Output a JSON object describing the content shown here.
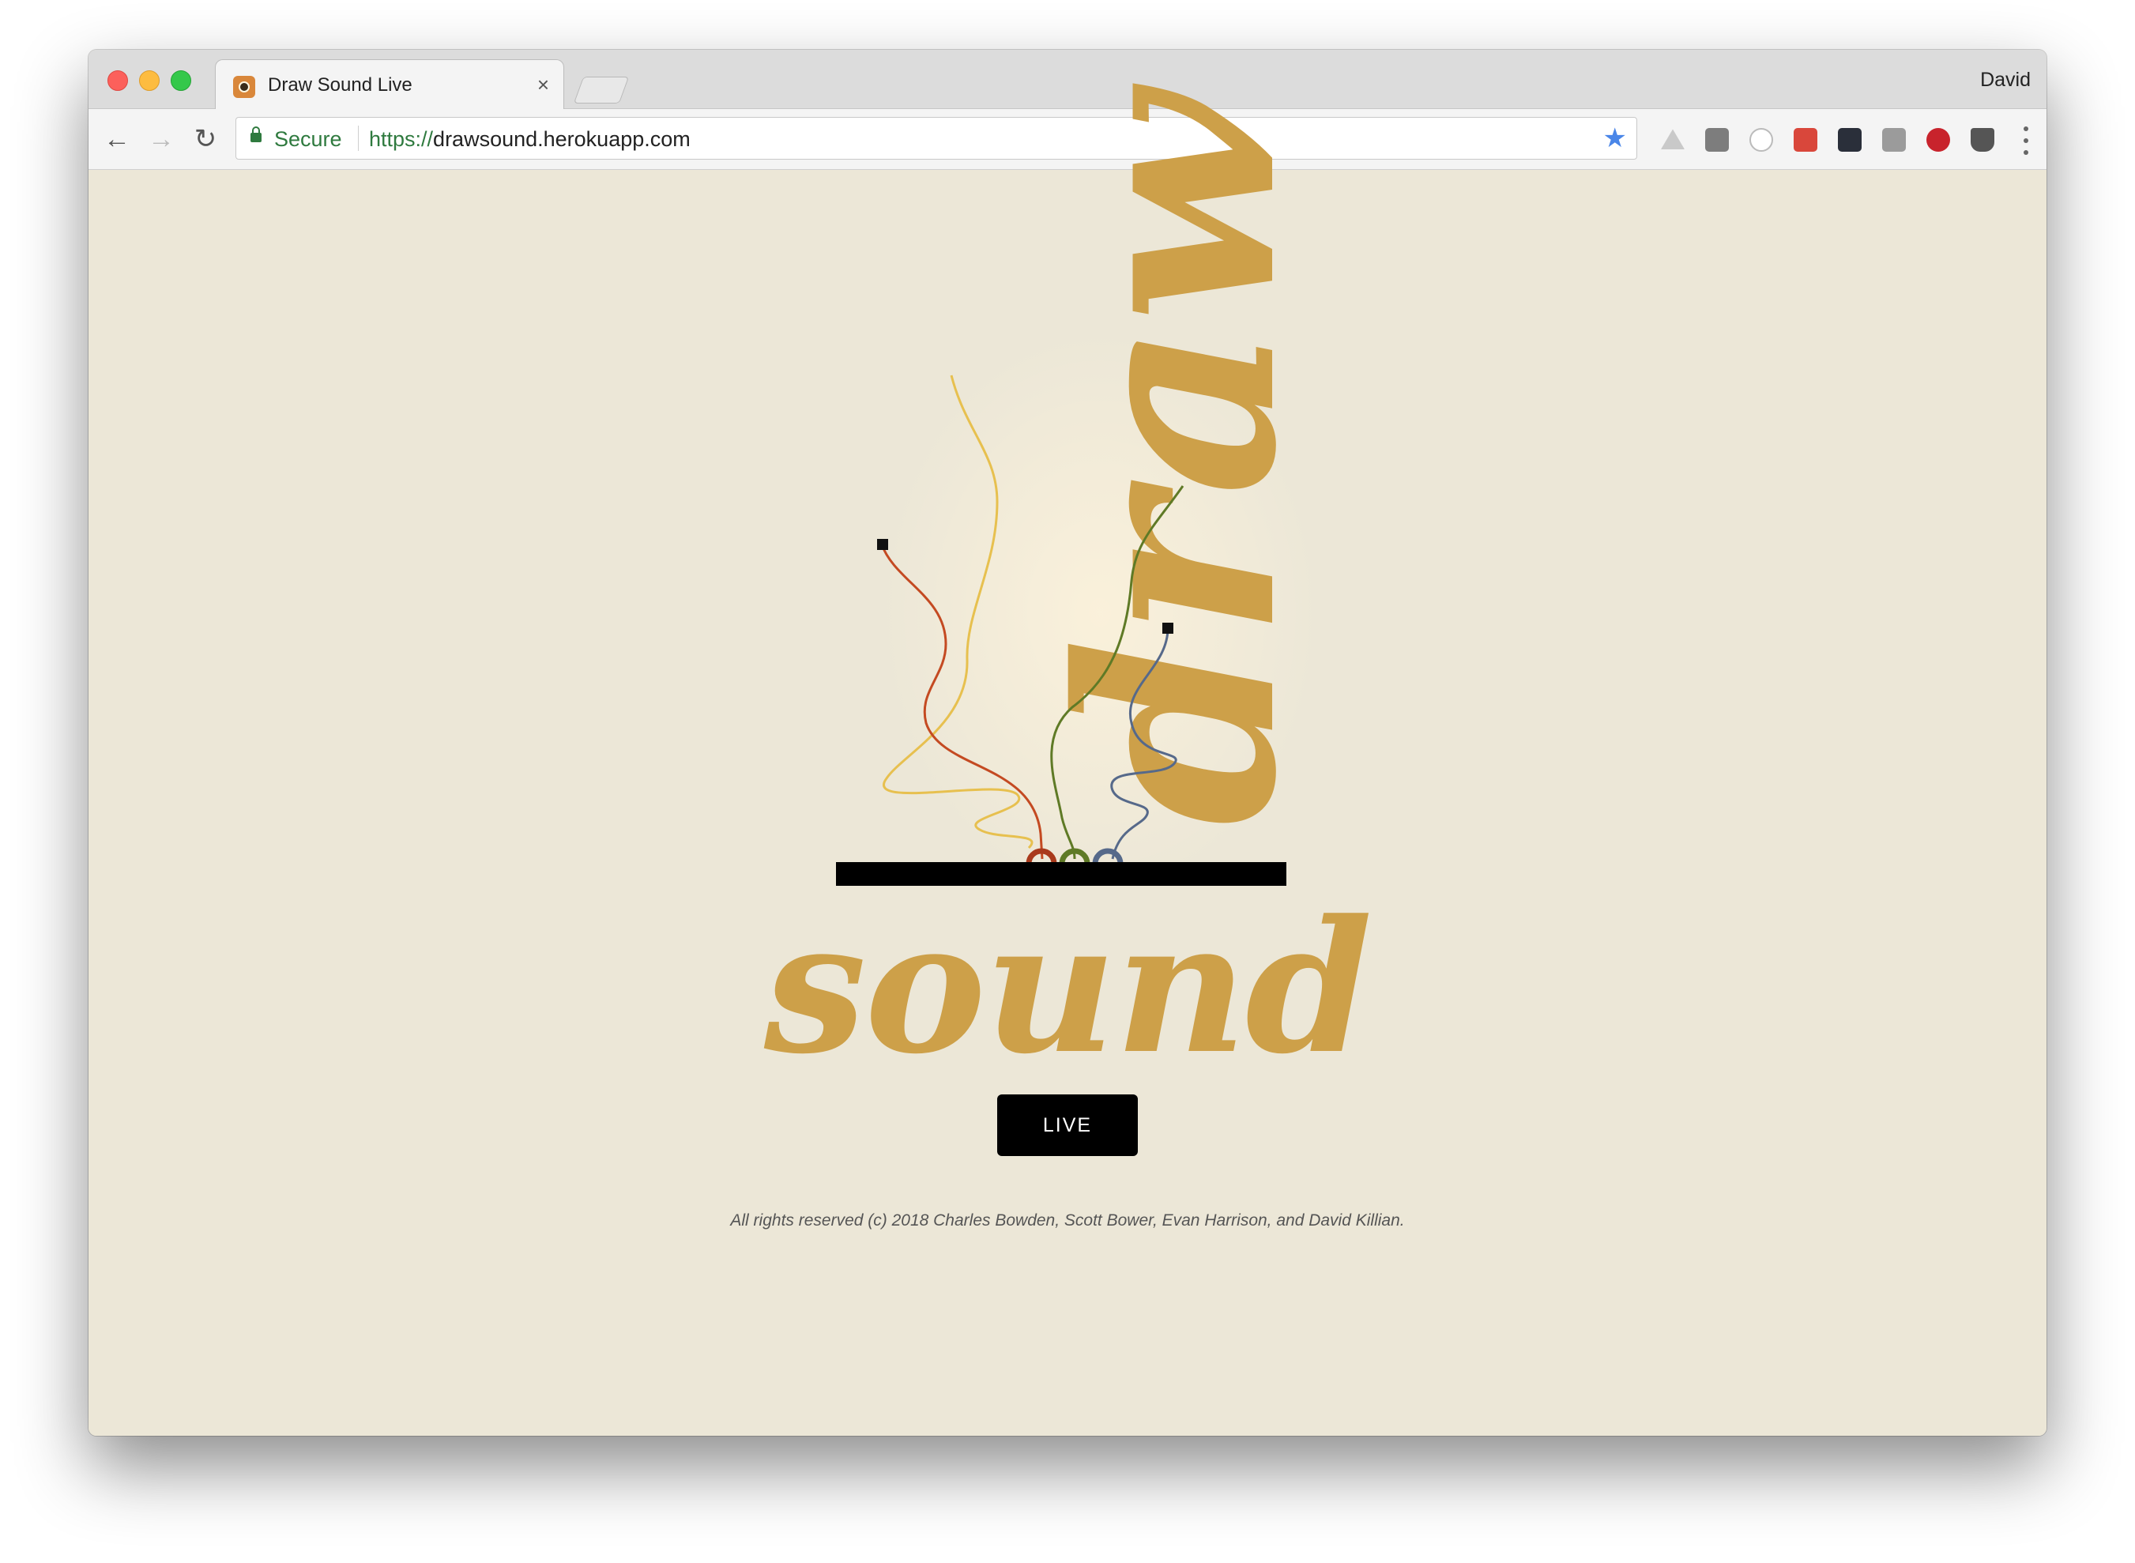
{
  "browser": {
    "tab_title": "Draw Sound Live",
    "tab_close": "×",
    "profile_name": "David",
    "secure_label": "Secure",
    "url_scheme": "https://",
    "url_host": "drawsound.herokuapp.com",
    "nav": {
      "back": "←",
      "forward": "→",
      "reload": "↻"
    },
    "star": "★",
    "extensions": [
      "google-drive-icon",
      "extension-icon",
      "extension-circle-icon",
      "lastpass-icon",
      "react-devtools-icon",
      "extension-icon",
      "pinterest-icon",
      "pocket-icon"
    ]
  },
  "page": {
    "logo_top": "draw",
    "logo_bottom": "sound",
    "live_button": "LIVE",
    "footer": "All rights reserved (c) 2018 Charles Bowden, Scott Bower, Evan Harrison, and David Killian."
  },
  "colors": {
    "page_bg": "#ece7d7",
    "logo": "#cda049",
    "wire_red": "#c44a22",
    "wire_yellow": "#e7c04f",
    "wire_green": "#5f7a26",
    "wire_blue": "#56698a",
    "secure_green": "#2f7a3f"
  }
}
